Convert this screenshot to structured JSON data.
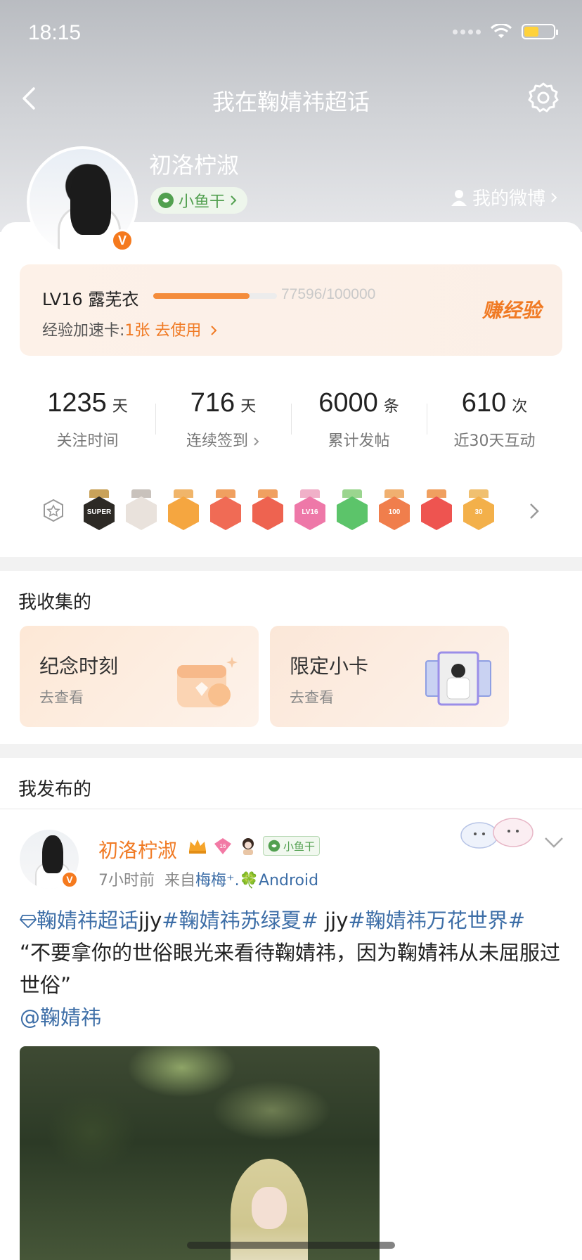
{
  "status": {
    "time": "18:15"
  },
  "nav": {
    "title": "我在鞠婧祎超话"
  },
  "profile": {
    "name": "初洛柠淑",
    "verified_label": "V",
    "fish_label": "小鱼干",
    "my_weibo_label": "我的微博"
  },
  "level": {
    "name": "LV16 露芜衣",
    "progress_text": "77596/100000",
    "progress_fraction": 0.776,
    "accel_label": "经验加速卡:",
    "accel_link": "1张 去使用",
    "earn_label": "赚经验"
  },
  "stats": [
    {
      "num": "1235",
      "unit": "天",
      "label": "关注时间"
    },
    {
      "num": "716",
      "unit": "天",
      "label": "连续签到"
    },
    {
      "num": "6000",
      "unit": "条",
      "label": "累计发帖"
    },
    {
      "num": "610",
      "unit": "次",
      "label": "近30天互动"
    }
  ],
  "badges": [
    {
      "label": "SUPER",
      "color": "#2d2a25",
      "rib": "#c9a25a"
    },
    {
      "label": "",
      "color": "#e9e2dc",
      "rib": "#c9c2bc"
    },
    {
      "label": "",
      "color": "#f5a640",
      "rib": "#f0b56a"
    },
    {
      "label": "",
      "color": "#f06b55",
      "rib": "#f0a060"
    },
    {
      "label": "",
      "color": "#ee6350",
      "rib": "#f0a060"
    },
    {
      "label": "LV16",
      "color": "#ee78a8",
      "rib": "#f0b0c8"
    },
    {
      "label": "",
      "color": "#5cc46a",
      "rib": "#9bd58f"
    },
    {
      "label": "100",
      "color": "#f07e4c",
      "rib": "#f0b070"
    },
    {
      "label": "",
      "color": "#ee5450",
      "rib": "#f0a060"
    },
    {
      "label": "30",
      "color": "#f3b04a",
      "rib": "#f0c070"
    }
  ],
  "collected": {
    "title": "我收集的",
    "items": [
      {
        "title": "纪念时刻",
        "sub": "去查看"
      },
      {
        "title": "限定小卡",
        "sub": "去查看"
      }
    ]
  },
  "published": {
    "title": "我发布的"
  },
  "post": {
    "author": "初洛柠淑",
    "fish_label": "小鱼干",
    "time": "7小时前",
    "from_label": "来自",
    "source": "梅梅⁺.🍀Android",
    "tag1": "鞠婧祎超话",
    "text1": "jjy",
    "tag2": "#鞠婧祎苏绿夏#",
    "text2": " jjy",
    "tag3": "#鞠婧祎万花世界#",
    "quote": "“不要拿你的世俗眼光来看待鞠婧祎，因为鞠婧祎从未屈服过世俗”",
    "mention": "@鞠婧祎"
  },
  "colors": {
    "accent": "#f07a24",
    "link": "#3d6ea7",
    "green": "#52a050"
  }
}
